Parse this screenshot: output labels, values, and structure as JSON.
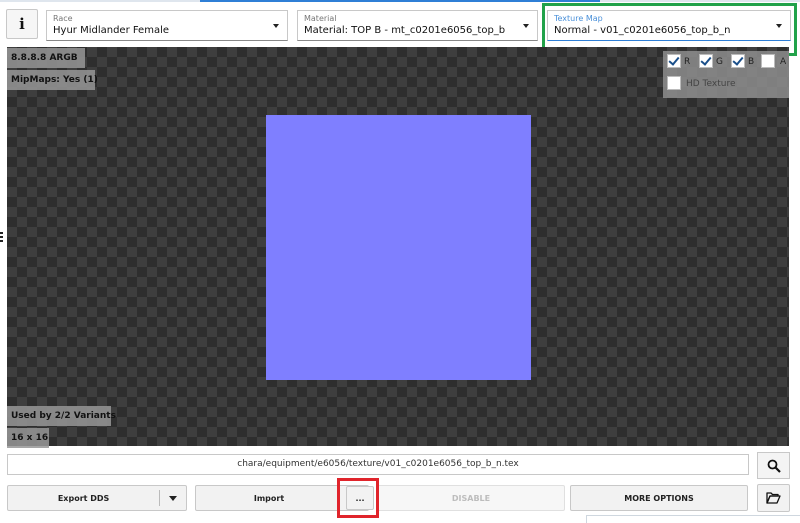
{
  "toolbar": {
    "info_glyph": "i",
    "race": {
      "label": "Race",
      "value": "Hyur Midlander Female"
    },
    "material": {
      "label": "Material",
      "value": "Material: TOP B - mt_c0201e6056_top_b"
    },
    "texture_map": {
      "label": "Texture Map",
      "value": "Normal - v01_c0201e6056_top_b_n"
    }
  },
  "viewer": {
    "format": "8.8.8.8   ARGB",
    "mipmaps": "MipMaps: Yes (1)",
    "used_by": "Used by 2/2 Variants",
    "size": "16 x 16",
    "texture_color": "#7f7fff",
    "channels": [
      {
        "label": "R",
        "checked": true
      },
      {
        "label": "G",
        "checked": true
      },
      {
        "label": "B",
        "checked": true
      },
      {
        "label": "A",
        "checked": false
      }
    ],
    "hd_texture": {
      "label": "HD Texture",
      "checked": false
    }
  },
  "path": {
    "value": "chara/equipment/e6056/texture/v01_c0201e6056_top_b_n.tex",
    "search_icon": "magnifier-icon"
  },
  "actions": {
    "export": "Export  DDS",
    "import": "Import",
    "more_dots": "...",
    "disable": "DISABLE",
    "more_options": "MORE OPTIONS",
    "folder_icon": "folder-open-icon"
  },
  "highlight_colors": {
    "green": "#22a24a",
    "red": "#e0242b"
  }
}
